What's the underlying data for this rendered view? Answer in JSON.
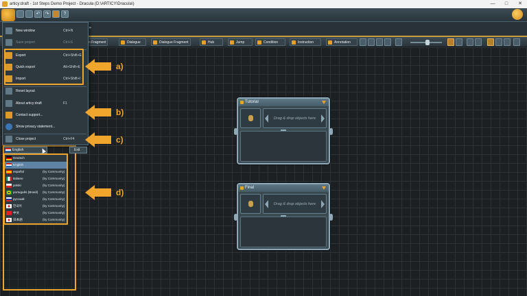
{
  "window": {
    "title": "articy:draft - 1st Steps Demo Project - Dracula (D:\\ARTICY\\Dracula\\)",
    "controls": [
      "—",
      "□",
      "✕"
    ]
  },
  "toolbar": {
    "items": [
      "n Fragment",
      "Dialogue",
      "Dialogue Fragment",
      "Hub",
      "Jump",
      "Condition",
      "Instruction",
      "Annotation"
    ]
  },
  "file_menu": {
    "items": [
      {
        "label": "New window",
        "shortcut": "Ctrl+N",
        "enabled": true
      },
      {
        "label": "Save project",
        "shortcut": "Ctrl+S",
        "enabled": false
      },
      {
        "label": "Export",
        "shortcut": "Ctrl+Shift+E",
        "enabled": true
      },
      {
        "label": "Quick export",
        "shortcut": "Alt+Shift+E",
        "enabled": true
      },
      {
        "label": "Import",
        "shortcut": "Ctrl+Shift+I",
        "enabled": true
      },
      {
        "label": "Reset layout",
        "shortcut": "",
        "enabled": true
      },
      {
        "label": "About articy:draft",
        "shortcut": "F1",
        "enabled": true
      },
      {
        "label": "Contact support...",
        "shortcut": "",
        "enabled": true
      },
      {
        "label": "Show privacy statement...",
        "shortcut": "",
        "enabled": true
      },
      {
        "label": "Close project",
        "shortcut": "Ctrl+F4",
        "enabled": true
      }
    ],
    "language_selected": "English",
    "exit_label": "Exit"
  },
  "languages": [
    {
      "name": "Deutsch",
      "note": ""
    },
    {
      "name": "English",
      "note": "",
      "selected": true
    },
    {
      "name": "español",
      "note": "(by Community)"
    },
    {
      "name": "italiano",
      "note": "(by Community)"
    },
    {
      "name": "polski",
      "note": "(by Community)"
    },
    {
      "name": "português (Brasil)",
      "note": "(by Community)"
    },
    {
      "name": "русский",
      "note": "(by Community)"
    },
    {
      "name": "한국어",
      "note": "(by Community)"
    },
    {
      "name": "中文",
      "note": "(by Community)"
    },
    {
      "name": "日本語",
      "note": "(by Community)"
    }
  ],
  "nodes": [
    {
      "title": "Tutorial",
      "drop_hint": "Drag & drop objects here"
    },
    {
      "title": "Final",
      "drop_hint": "Drag & drop objects here"
    }
  ],
  "annotations": [
    "a)",
    "b)",
    "c)",
    "d)"
  ],
  "colors": {
    "accent": "#f0a52c",
    "canvas": "#1c2022",
    "node_border": "#8fa9b8",
    "selection": "#5e83a5"
  }
}
